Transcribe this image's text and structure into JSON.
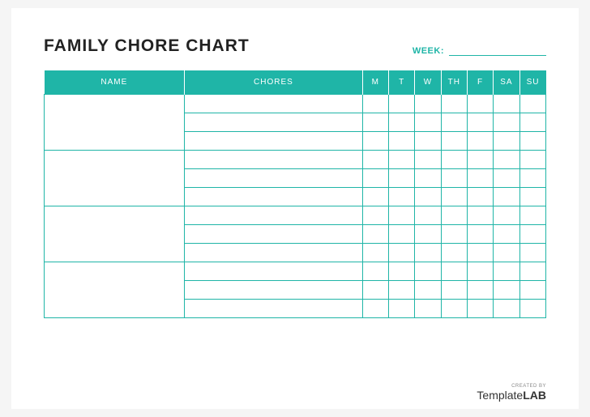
{
  "title": "FAMILY CHORE CHART",
  "week_label": "WEEK:",
  "columns": {
    "name": "NAME",
    "chores": "CHORES",
    "days": [
      "M",
      "T",
      "W",
      "TH",
      "F",
      "SA",
      "SU"
    ]
  },
  "groups": 4,
  "rows_per_group": 3,
  "footer": {
    "created_by": "CREATED BY",
    "brand_prefix": "Template",
    "brand_suffix": "LAB"
  }
}
